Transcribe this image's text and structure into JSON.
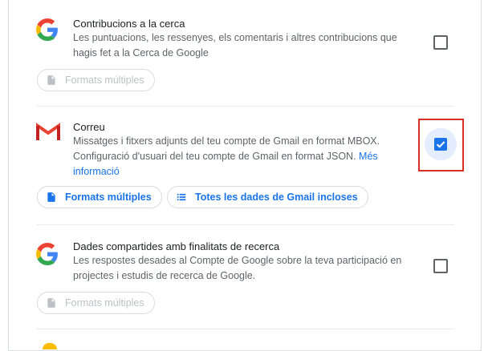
{
  "items": [
    {
      "title": "Contribucions a la cerca",
      "description": "Les puntuacions, les ressenyes, els comentaris i altres contribucions que hagis fet a la Cerca de Google",
      "format_label": "Formats múltiples",
      "logo": "google-g-icon",
      "checked": false
    },
    {
      "title": "Correu",
      "description": "Missatges i fitxers adjunts del teu compte de Gmail en format MBOX. Configuració d'usuari del teu compte de Gmail en format JSON.",
      "more_link": "Més informació",
      "format_label": "Formats múltiples",
      "data_label": "Totes les dades de Gmail incloses",
      "logo": "gmail-icon",
      "checked": true
    },
    {
      "title": "Dades compartides amb finalitats de recerca",
      "description": "Les respostes desades al Compte de Google sobre la teva participació en projectes i estudis de recerca de Google.",
      "format_label": "Formats múltiples",
      "logo": "google-g-icon",
      "checked": false
    }
  ],
  "colors": {
    "accent": "#1a73e8",
    "highlight": "#d93025",
    "disabled": "#bdc1c6"
  }
}
